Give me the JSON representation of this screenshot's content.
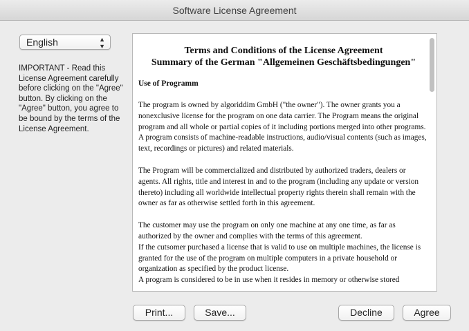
{
  "window": {
    "title": "Software License Agreement"
  },
  "language": {
    "selected": "English",
    "arrows_icon": "updown-chevron-icon"
  },
  "sidebar": {
    "important_text": "IMPORTANT - Read this License Agreement carefully before clicking on the \"Agree\" button. By clicking on the \"Agree\" button, you agree to be bound by the terms of the License Agreement."
  },
  "document": {
    "title_line1": "Terms and Conditions of the License Agreement",
    "title_line2": "Summary of the German \"Allgemeinen Geschäftsbedingungen\"",
    "section_heading": "Use of Programm",
    "paragraph1": "The program is owned by algoriddim GmbH (\"the owner\"). The owner grants you a nonexclusive license for the program on one data carrier. The Program means the original program and all whole or partial copies of it including portions merged into other programs. A program consists of machine-readable instructions, audio/visual contents (such as images, text, recordings or pictures) and related materials.",
    "paragraph2": "The Program will be commercialized and distributed by authorized traders, dealers or agents. All rights, title and interest in and to the program (including any update or version thereto) including all worldwide intellectual property rights therein shall remain with the owner as far as otherwise settled forth in this agreement.",
    "paragraph3a": "The customer may use the program on only one machine at any one time, as far as authorized by the owner and complies with the terms of this agreement.",
    "paragraph3b": "If the cutsomer purchased a license that is valid to use on multiple machines, the license is granted for the use of the program on multiple computers in a private household or organization as specified by the product license.",
    "paragraph3c": "A program is considered to be in use when it resides in memory or otherwise stored"
  },
  "buttons": {
    "print": "Print...",
    "save": "Save...",
    "decline": "Decline",
    "agree": "Agree"
  }
}
